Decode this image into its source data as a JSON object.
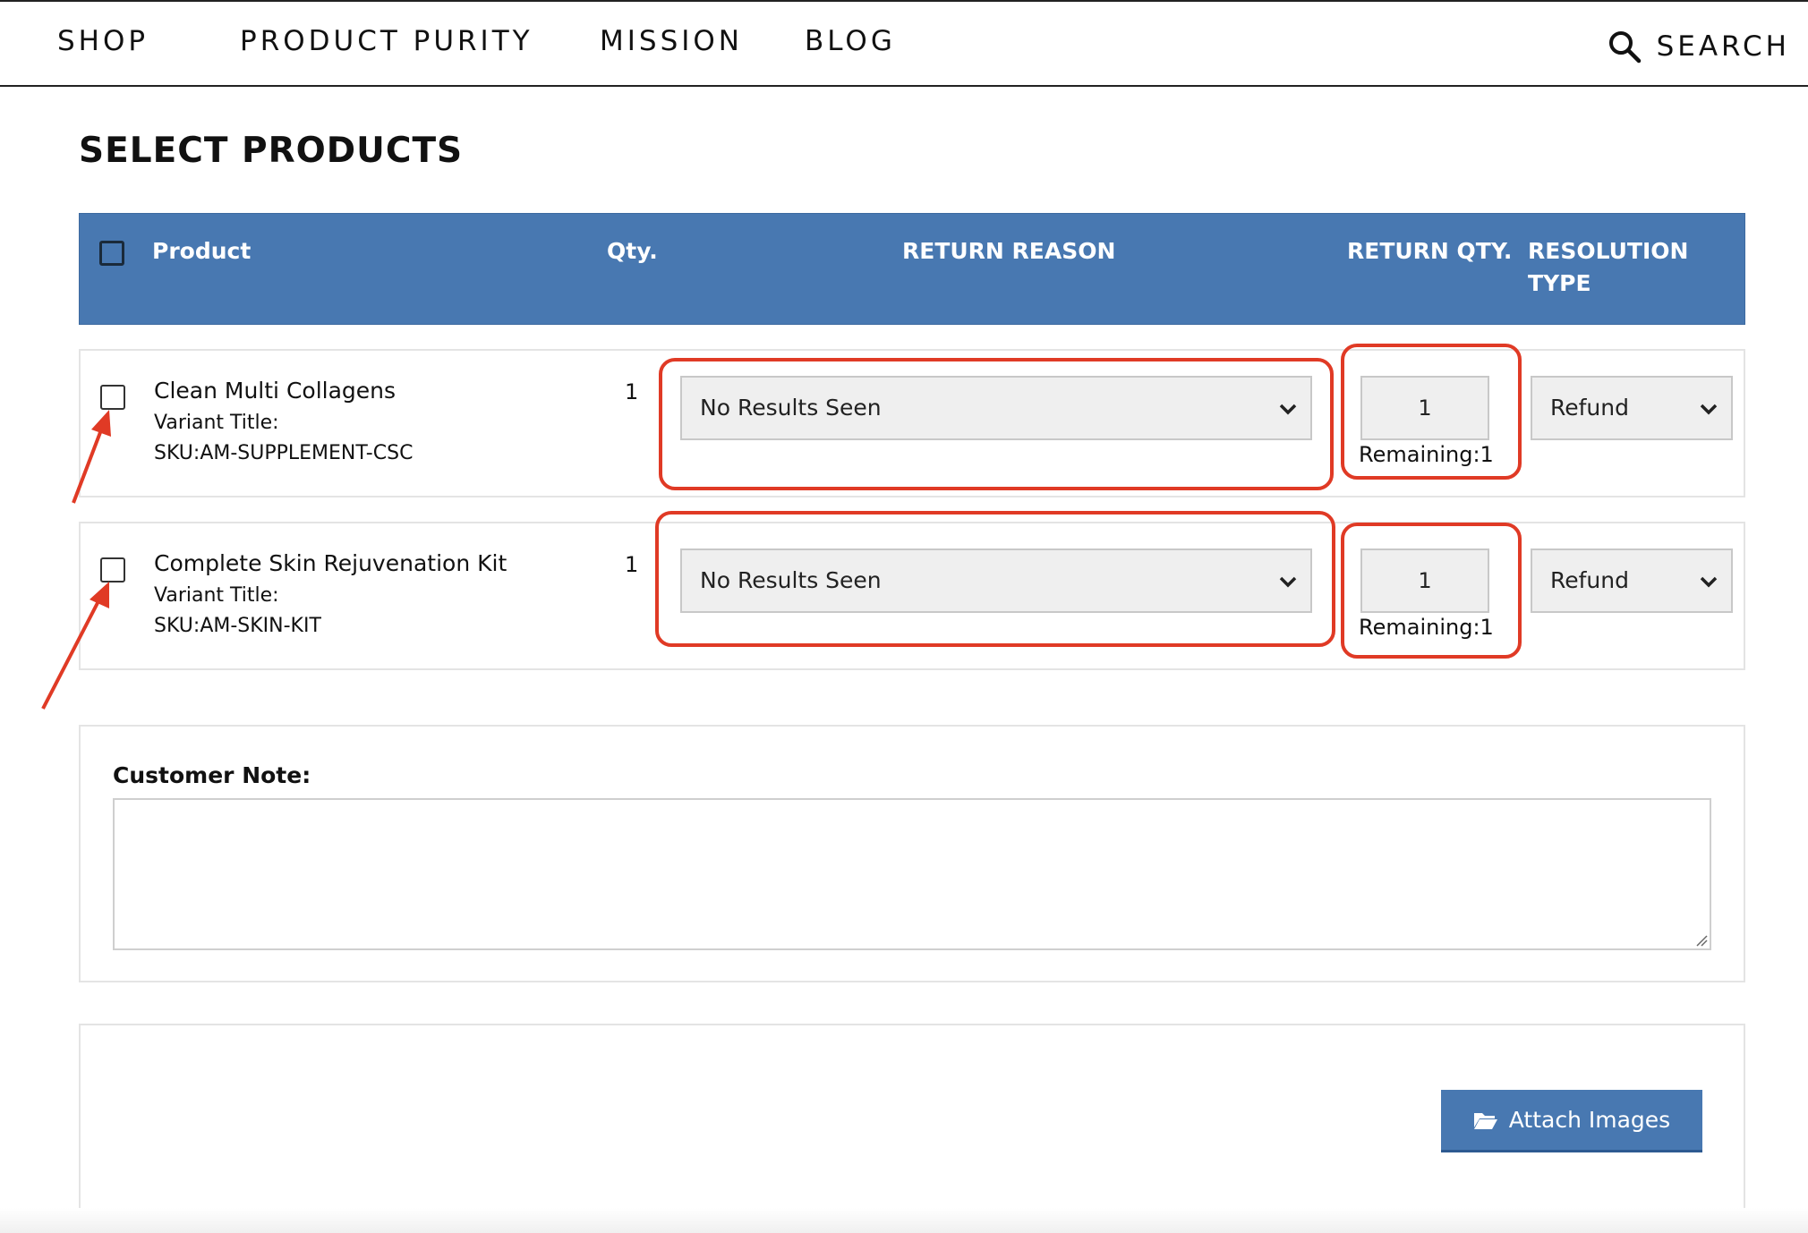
{
  "nav": {
    "items": [
      "SHOP",
      "PRODUCT PURITY",
      "MISSION",
      "BLOG"
    ],
    "search_label": "SEARCH"
  },
  "page": {
    "title": "SELECT PRODUCTS"
  },
  "table": {
    "headers": {
      "product": "Product",
      "qty": "Qty.",
      "return_reason": "RETURN REASON",
      "return_qty": "RETURN QTY.",
      "resolution_type_line1": "RESOLUTION",
      "resolution_type_line2": "TYPE"
    },
    "rows": [
      {
        "name": "Clean Multi Collagens",
        "variant": "Variant Title:",
        "sku": "SKU:AM-SUPPLEMENT-CSC",
        "qty": "1",
        "return_reason": "No Results Seen",
        "return_qty": "1",
        "remaining": "Remaining:1",
        "resolution": "Refund",
        "checked": false
      },
      {
        "name": "Complete Skin Rejuvenation Kit",
        "variant": "Variant Title:",
        "sku": "SKU:AM-SKIN-KIT",
        "qty": "1",
        "return_reason": "No Results Seen",
        "return_qty": "1",
        "remaining": "Remaining:1",
        "resolution": "Refund",
        "checked": false
      }
    ]
  },
  "note": {
    "label": "Customer Note:",
    "value": ""
  },
  "attach": {
    "label": "Attach Images"
  },
  "colors": {
    "header_blue": "#4878b1",
    "annotation_red": "#e03a25"
  },
  "icons": [
    "search-icon",
    "chevron-down-icon",
    "folder-open-icon",
    "arrow-annotation"
  ]
}
